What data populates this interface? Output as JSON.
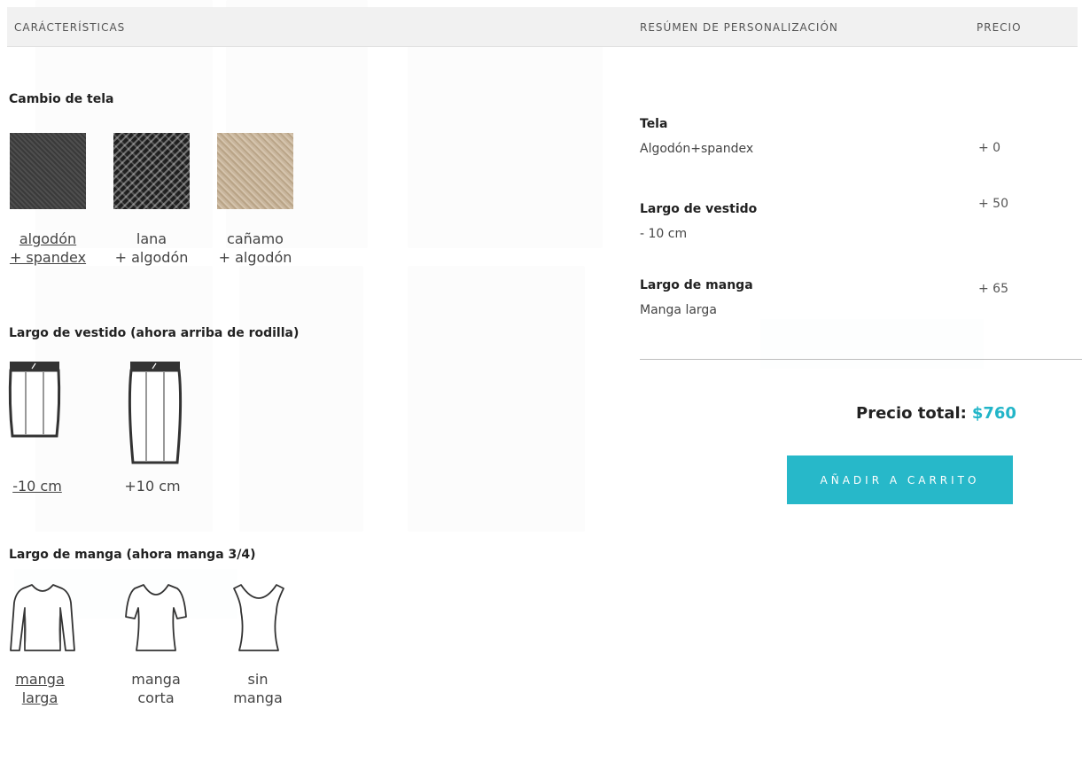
{
  "header": {
    "features": "CARÁCTERÍSTICAS",
    "summary": "RESÚMEN DE PERSONALIZACIÓN",
    "price": "PRECIO"
  },
  "fabric": {
    "title": "Cambio de tela",
    "options": [
      {
        "line1": "algodón",
        "line2": "+ spandex",
        "selected": true,
        "icon": "denim-swatch-icon"
      },
      {
        "line1": "lana",
        "line2": "+ algodón",
        "selected": false,
        "icon": "wool-swatch-icon"
      },
      {
        "line1": "cañamo",
        "line2": "+ algodón",
        "selected": false,
        "icon": "hemp-swatch-icon"
      }
    ]
  },
  "dress_length": {
    "title": "Largo de vestido (ahora arriba de rodilla)",
    "options": [
      {
        "label": "-10 cm",
        "selected": true,
        "icon": "short-skirt-icon"
      },
      {
        "label": "+10 cm",
        "selected": false,
        "icon": "long-skirt-icon"
      }
    ]
  },
  "sleeve_length": {
    "title": "Largo de manga (ahora manga 3/4)",
    "options": [
      {
        "line1": "manga",
        "line2": "larga",
        "selected": true,
        "icon": "long-sleeve-icon"
      },
      {
        "line1": "manga",
        "line2": "corta",
        "selected": false,
        "icon": "short-sleeve-icon"
      },
      {
        "line1": "sin",
        "line2": "manga",
        "selected": false,
        "icon": "sleeveless-icon"
      }
    ]
  },
  "summary": {
    "items": [
      {
        "title": "Tela",
        "value": "Algodón+spandex",
        "price": "+ 0"
      },
      {
        "title": "Largo de vestido",
        "value": "- 10 cm",
        "price": "+ 50"
      },
      {
        "title": "Largo de manga",
        "value": "Manga larga",
        "price": "+ 65"
      }
    ],
    "total_label": "Precio total:",
    "total_value": "$760",
    "cart_button": "AÑADIR A CARRITO"
  },
  "colors": {
    "accent": "#27b8c9",
    "header_bg": "#f1f1f1"
  }
}
